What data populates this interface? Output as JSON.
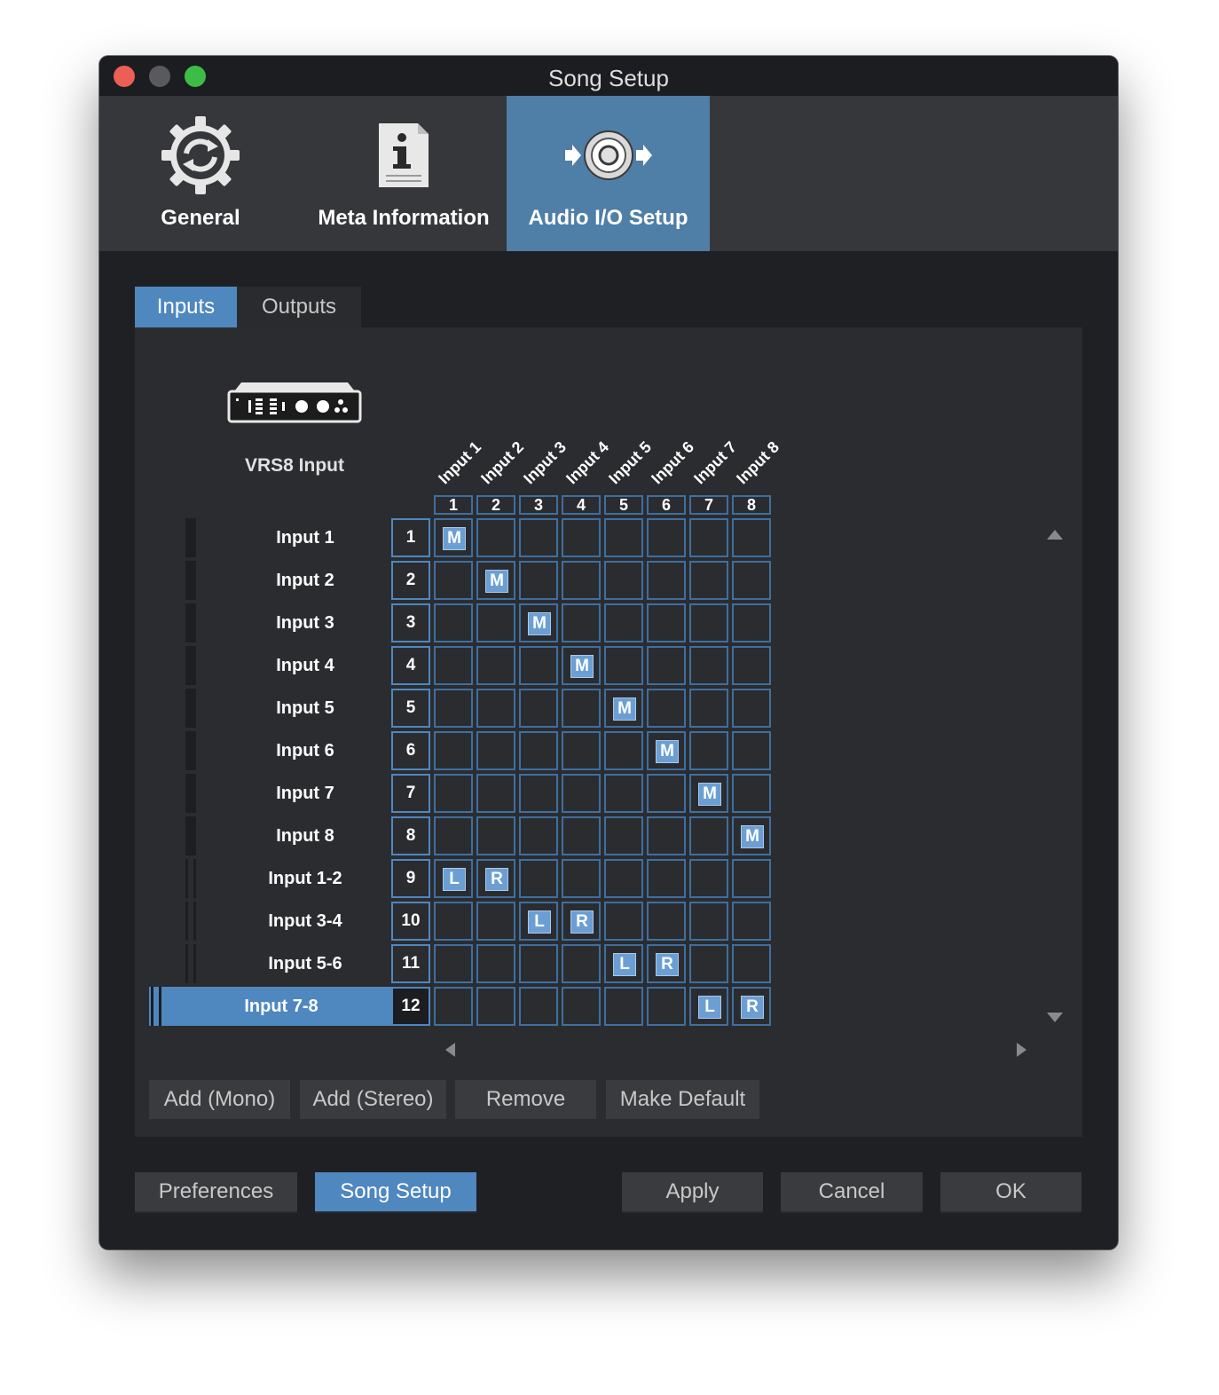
{
  "window": {
    "title": "Song Setup",
    "traffic_colors": [
      "#ec5f57",
      "#5a5a5d",
      "#3dbd47"
    ]
  },
  "tabs": [
    {
      "label": "General",
      "icon": "gear-sync-icon",
      "active": false
    },
    {
      "label": "Meta Information",
      "icon": "info-document-icon",
      "active": false
    },
    {
      "label": "Audio I/O Setup",
      "icon": "audio-io-icon",
      "active": true
    }
  ],
  "subtabs": [
    {
      "label": "Inputs",
      "active": true
    },
    {
      "label": "Outputs",
      "active": false
    }
  ],
  "device": {
    "name": "VRS8 Input",
    "icon": "audio-interface-icon"
  },
  "columns": [
    {
      "label": "Input 1",
      "num": "1"
    },
    {
      "label": "Input 2",
      "num": "2"
    },
    {
      "label": "Input 3",
      "num": "3"
    },
    {
      "label": "Input 4",
      "num": "4"
    },
    {
      "label": "Input 5",
      "num": "5"
    },
    {
      "label": "Input 6",
      "num": "6"
    },
    {
      "label": "Input 7",
      "num": "7"
    },
    {
      "label": "Input 8",
      "num": "8"
    }
  ],
  "rows": [
    {
      "name": "Input 1",
      "num": "1",
      "stereo": false,
      "selected": false,
      "marks": {
        "0": "M"
      }
    },
    {
      "name": "Input 2",
      "num": "2",
      "stereo": false,
      "selected": false,
      "marks": {
        "1": "M"
      }
    },
    {
      "name": "Input 3",
      "num": "3",
      "stereo": false,
      "selected": false,
      "marks": {
        "2": "M"
      }
    },
    {
      "name": "Input 4",
      "num": "4",
      "stereo": false,
      "selected": false,
      "marks": {
        "3": "M"
      }
    },
    {
      "name": "Input 5",
      "num": "5",
      "stereo": false,
      "selected": false,
      "marks": {
        "4": "M"
      }
    },
    {
      "name": "Input 6",
      "num": "6",
      "stereo": false,
      "selected": false,
      "marks": {
        "5": "M"
      }
    },
    {
      "name": "Input 7",
      "num": "7",
      "stereo": false,
      "selected": false,
      "marks": {
        "6": "M"
      }
    },
    {
      "name": "Input 8",
      "num": "8",
      "stereo": false,
      "selected": false,
      "marks": {
        "7": "M"
      }
    },
    {
      "name": "Input 1-2",
      "num": "9",
      "stereo": true,
      "selected": false,
      "marks": {
        "0": "L",
        "1": "R"
      }
    },
    {
      "name": "Input 3-4",
      "num": "10",
      "stereo": true,
      "selected": false,
      "marks": {
        "2": "L",
        "3": "R"
      }
    },
    {
      "name": "Input 5-6",
      "num": "11",
      "stereo": true,
      "selected": false,
      "marks": {
        "4": "L",
        "5": "R"
      }
    },
    {
      "name": "Input 7-8",
      "num": "12",
      "stereo": true,
      "selected": true,
      "marks": {
        "6": "L",
        "7": "R"
      }
    }
  ],
  "panel_buttons": [
    {
      "label": "Add (Mono)"
    },
    {
      "label": "Add (Stereo)"
    },
    {
      "label": "Remove"
    },
    {
      "label": "Make Default"
    }
  ],
  "footer": {
    "left": [
      {
        "label": "Preferences",
        "active": false
      },
      {
        "label": "Song Setup",
        "active": true
      }
    ],
    "right": [
      {
        "label": "Apply"
      },
      {
        "label": "Cancel"
      },
      {
        "label": "OK"
      }
    ]
  }
}
